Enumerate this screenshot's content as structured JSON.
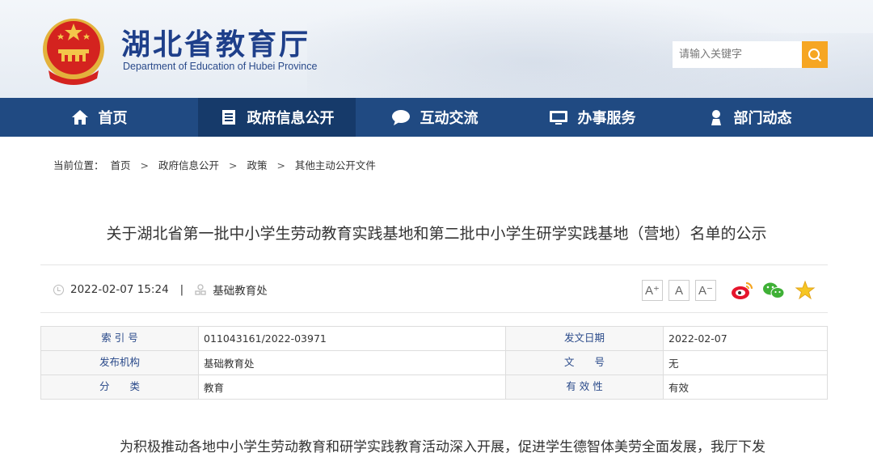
{
  "header": {
    "title": "湖北省教育厅",
    "subtitle": "Department of Education of Hubei Province",
    "search_placeholder": "请输入关键字"
  },
  "nav": {
    "items": [
      {
        "label": "首页",
        "icon": "home-icon"
      },
      {
        "label": "政府信息公开",
        "icon": "document-icon",
        "active": true
      },
      {
        "label": "互动交流",
        "icon": "chat-icon"
      },
      {
        "label": "办事服务",
        "icon": "monitor-icon"
      },
      {
        "label": "部门动态",
        "icon": "person-icon"
      }
    ]
  },
  "breadcrumb": {
    "prefix": "当前位置：",
    "items": [
      "首页",
      "政府信息公开",
      "政策",
      "其他主动公开文件"
    ],
    "separator": ">"
  },
  "article": {
    "title": "关于湖北省第一批中小学生劳动教育实践基地和第二批中小学生研学实践基地（营地）名单的公示",
    "datetime": "2022-02-07 15:24",
    "separator": "|",
    "department": "基础教育处",
    "first_line": "为积极推动各地中小学生劳动教育和研学实践教育活动深入开展，促进学生德智体美劳全面发展，我厅下发"
  },
  "font_controls": [
    "A⁺",
    "A",
    "A⁻"
  ],
  "share_icons": [
    "weibo-icon",
    "wechat-icon",
    "favorite-star-icon"
  ],
  "info_table": {
    "rows": [
      {
        "k1": "索 引 号",
        "v1": "011043161/2022-03971",
        "k2": "发文日期",
        "v2": "2022-02-07"
      },
      {
        "k1": "发布机构",
        "v1": "基础教育处",
        "k2": "文　　号",
        "v2": "无"
      },
      {
        "k1": "分　　类",
        "v1": "教育",
        "k2": "有 效 性",
        "v2": "有效"
      }
    ]
  },
  "colors": {
    "nav_bg": "#204a82",
    "nav_active": "#163a6a",
    "title_blue": "#1e3f8a",
    "search_button": "#f6a623"
  }
}
